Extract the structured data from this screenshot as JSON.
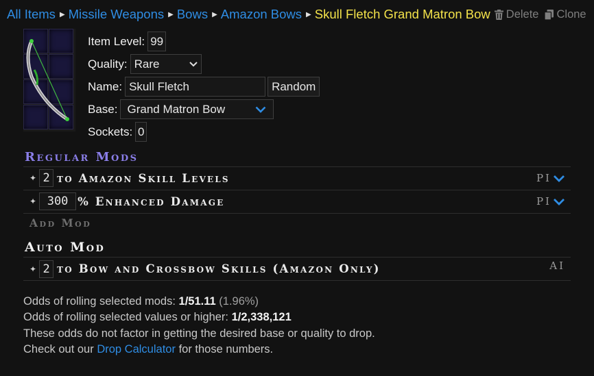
{
  "breadcrumb": {
    "items": [
      "All Items",
      "Missile Weapons",
      "Bows",
      "Amazon Bows"
    ],
    "current": "Skull Fletch Grand Matron Bow",
    "delete_label": "Delete",
    "clone_label": "Clone"
  },
  "item": {
    "level_label": "Item Level:",
    "level_value": "99",
    "quality_label": "Quality:",
    "quality_value": "Rare",
    "name_label": "Name:",
    "name_value": "Skull Fletch",
    "random_label": "Random",
    "base_label": "Base:",
    "base_value": "Grand Matron Bow",
    "sockets_label": "Sockets:",
    "sockets_value": "0"
  },
  "regular_mods": {
    "heading": "Regular Mods",
    "mods": [
      {
        "value": "2",
        "text": "to Amazon Skill Levels",
        "tag": "PI"
      },
      {
        "value": "300",
        "text": "% Enhanced Damage",
        "tag": "PI"
      }
    ],
    "add_label": "Add Mod"
  },
  "auto_mod": {
    "heading": "Auto Mod",
    "mods": [
      {
        "value": "2",
        "text": "to Bow and Crossbow Skills (Amazon Only)",
        "tag": "AI"
      }
    ]
  },
  "odds": {
    "line1_label": "Odds of rolling selected mods:",
    "line1_value": "1/51.11",
    "line1_pct": "(1.96%)",
    "line2_label": "Odds of rolling selected values or higher:",
    "line2_value": "1/2,338,121",
    "line3": "These odds do not factor in getting the desired base or quality to drop.",
    "line4_pre": "Check out our",
    "line4_link": "Drop Calculator",
    "line4_post": "for those numbers."
  },
  "colors": {
    "link": "#2f8de4",
    "current": "#f3e24a",
    "regular_heading": "#8a7ee8",
    "background": "#121212"
  },
  "icons": [
    "trash-icon",
    "copy-icon",
    "chevron-down-icon",
    "caret-right-icon",
    "bullet-icon"
  ]
}
